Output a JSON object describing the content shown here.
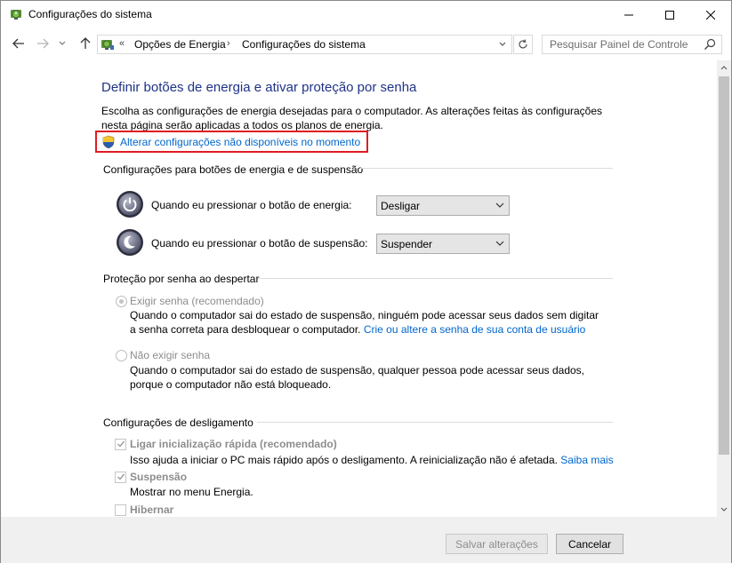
{
  "window": {
    "title": "Configurações do sistema"
  },
  "nav": {
    "breadcrumb_root": "«",
    "breadcrumb": [
      "Opções de Energia",
      "Configurações do sistema"
    ],
    "breadcrumb_sep": "›",
    "search_placeholder": "Pesquisar Painel de Controle"
  },
  "page": {
    "title": "Definir botões de energia e ativar proteção por senha",
    "intro": "Escolha as configurações de energia desejadas para o computador. As alterações feitas às configurações nesta página serão aplicadas a todos os planos de energia.",
    "admin_link": "Alterar configurações não disponíveis no momento"
  },
  "power_buttons": {
    "heading": "Configurações para botões de energia e de suspensão",
    "rows": [
      {
        "label": "Quando eu pressionar o botão de energia:",
        "value": "Desligar",
        "icon": "power-button-icon"
      },
      {
        "label": "Quando eu pressionar o botão de suspensão:",
        "value": "Suspender",
        "icon": "sleep-button-icon"
      }
    ]
  },
  "password": {
    "heading": "Proteção por senha ao despertar",
    "require": {
      "label": "Exigir senha (recomendado)",
      "selected": true,
      "desc_line1": "Quando o computador sai do estado de suspensão, ninguém pode acessar seus dados sem digitar",
      "desc_line2_prefix": "a senha correta para desbloquear o computador. ",
      "desc_link": "Crie ou altere a senha de sua conta de usuário"
    },
    "no_require": {
      "label": "Não exigir senha",
      "selected": false,
      "desc_line1": "Quando o computador sai do estado de suspensão, qualquer pessoa pode acessar seus dados,",
      "desc_line2": "porque o computador não está bloqueado."
    }
  },
  "shutdown": {
    "heading": "Configurações de desligamento",
    "items": [
      {
        "label": "Ligar inicialização rápida (recomendado)",
        "checked": true,
        "desc": "Isso ajuda a iniciar o PC mais rápido após o desligamento. A reinicialização não é afetada. ",
        "link": "Saiba mais"
      },
      {
        "label": "Suspensão",
        "checked": true,
        "desc": "Mostrar no menu Energia."
      },
      {
        "label": "Hibernar",
        "checked": false,
        "desc": ""
      }
    ]
  },
  "footer": {
    "save_label": "Salvar alterações",
    "cancel_label": "Cancelar"
  },
  "colors": {
    "title_blue": "#1e3287",
    "link_blue": "#0066cc",
    "highlight_red": "#e01b24"
  }
}
